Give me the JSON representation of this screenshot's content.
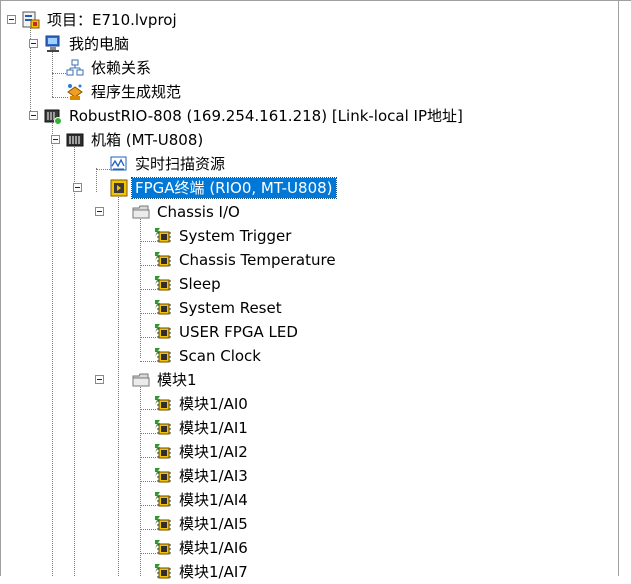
{
  "tree": {
    "project": {
      "label": "项目：E710.lvproj",
      "icon": "project-icon"
    },
    "my_computer": {
      "label": "我的电脑",
      "icon": "computer-icon"
    },
    "dependencies": {
      "label": "依赖关系",
      "icon": "dependencies-icon"
    },
    "build_specs": {
      "label": "程序生成规范",
      "icon": "build-specs-icon"
    },
    "target": {
      "label": "RobustRIO-808 (169.254.161.218) [Link-local IP地址]",
      "icon": "rio-target-icon"
    },
    "chassis": {
      "label": "机箱 (MT-U808)",
      "icon": "chassis-icon"
    },
    "scan_engine": {
      "label": "实时扫描资源",
      "icon": "scan-engine-icon"
    },
    "fpga": {
      "label": "FPGA终端 (RIO0, MT-U808)",
      "icon": "fpga-target-icon",
      "selected": true
    },
    "chassis_io": {
      "label": "Chassis I/O",
      "icon": "folder-icon",
      "items": [
        "System Trigger",
        "Chassis Temperature",
        "Sleep",
        "System Reset",
        "USER FPGA LED",
        "Scan Clock"
      ]
    },
    "module1": {
      "label": "模块1",
      "icon": "folder-icon",
      "items": [
        "模块1/AI0",
        "模块1/AI1",
        "模块1/AI2",
        "模块1/AI3",
        "模块1/AI4",
        "模块1/AI5",
        "模块1/AI6",
        "模块1/AI7"
      ]
    },
    "io_item_icon": "fpga-io-icon"
  },
  "colors": {
    "selection": "#0078d7",
    "selection_text": "#ffffff",
    "tree_lines": "#7a7a7a"
  }
}
